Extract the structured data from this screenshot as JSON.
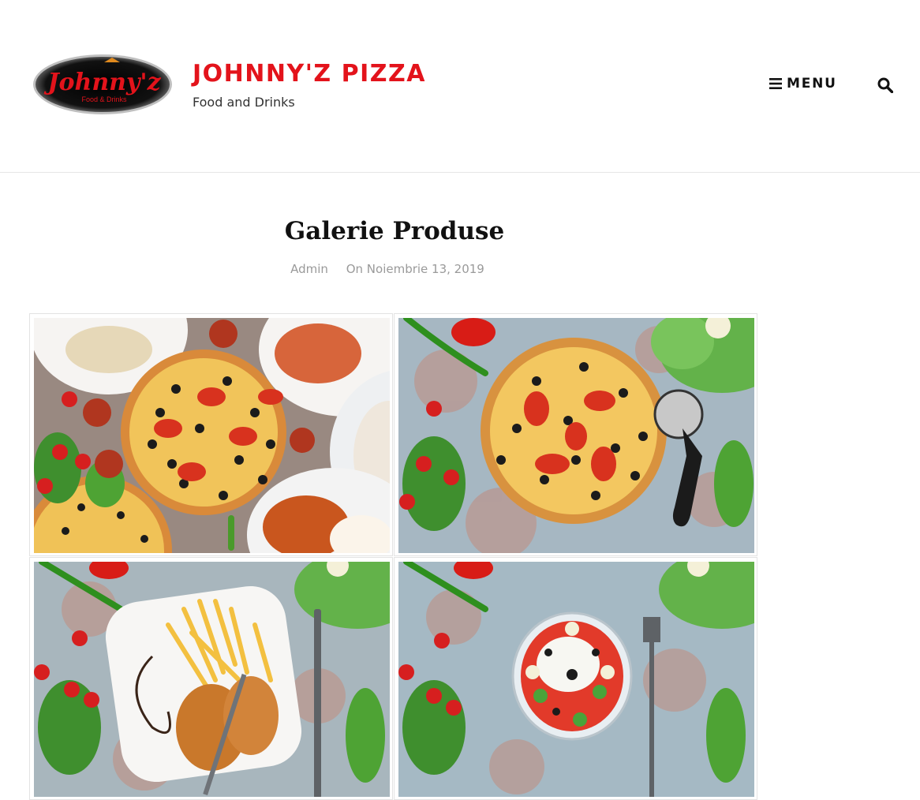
{
  "header": {
    "logo_text": "Johnny'z",
    "logo_subtext": "Food & Drinks",
    "site_title": "JOHNNY'Z PIZZA",
    "tagline": "Food and Drinks",
    "menu_label": "MENU",
    "menu_icon": "hamburger-icon",
    "search_icon": "search-icon"
  },
  "post": {
    "title": "Galerie Produse",
    "author": "Admin",
    "date": "On Noiembrie 13, 2019"
  },
  "gallery": {
    "items": [
      {
        "subject": "pizza-spread"
      },
      {
        "subject": "pizza-with-cutter"
      },
      {
        "subject": "schnitzel-and-fries"
      },
      {
        "subject": "greek-salad"
      }
    ]
  },
  "colors": {
    "brand_red": "#e3131b",
    "meta_gray": "#9a9a9a",
    "text_dark": "#111111"
  }
}
